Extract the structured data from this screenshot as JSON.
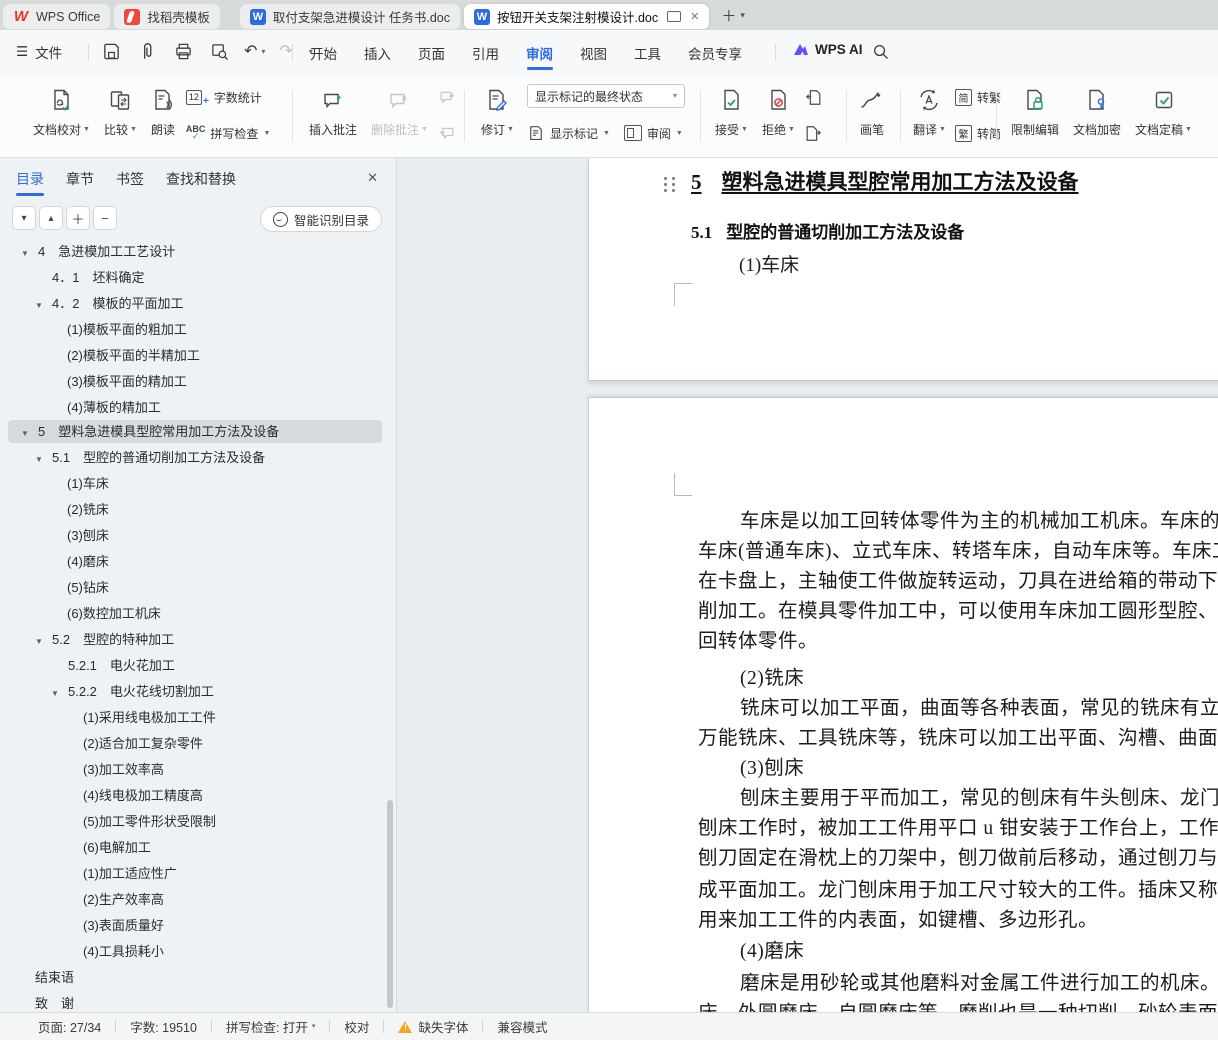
{
  "colors": {
    "accent": "#2e6be5",
    "green": "#2da05a",
    "red": "#d9414c",
    "warn": "#f2a71d",
    "page_bg": "#e8eef0"
  },
  "glyphs": {
    "tri_down": "▼",
    "caret": "▾",
    "caret_up": "▴",
    "plus": "＋",
    "minus": "−",
    "close": "✕",
    "hamburger": "☰",
    "undo": "↶",
    "redo": "↷",
    "check": "✓",
    "slash": "⊘",
    "letter_a": "a",
    "abc": "ABC",
    "num12": "12",
    "plus_s": "+",
    "zh": "文",
    "en": "A",
    "launcher": "◢",
    "warn_mark": "!"
  },
  "titlebar": {
    "tabs": [
      {
        "label": "WPS Office"
      },
      {
        "label": "找稻壳模板"
      },
      {
        "label": "取付支架急进模设计 任务书.doc"
      },
      {
        "label": "按钮开关支架注射模设计.doc",
        "active": true
      }
    ]
  },
  "menubar": {
    "file_label": "文件",
    "items": [
      "开始",
      "插入",
      "页面",
      "引用",
      "审阅",
      "视图",
      "工具",
      "会员专享"
    ],
    "active_item": "审阅",
    "wps_ai_label": "WPS AI"
  },
  "ribbon": {
    "proof": "文档校对",
    "compare": "比较",
    "read": "朗读",
    "wordcount": "字数统计",
    "spellcheck": "拼写检查",
    "insert_comment": "插入批注",
    "delete_comment": "删除批注",
    "track": "修订",
    "markup_state": "显示标记的最终状态",
    "show_markup": "显示标记",
    "review_pane": "审阅",
    "accept": "接受",
    "reject": "拒绝",
    "brush": "画笔",
    "translate": "翻译",
    "to_trad_icon": "简",
    "to_trad": "转繁",
    "to_simp_icon": "繁",
    "to_simp": "转简",
    "restrict": "限制编辑",
    "encrypt": "文档加密",
    "finalize": "文档定稿"
  },
  "sidebar": {
    "tabs": [
      "目录",
      "章节",
      "书签",
      "查找和替换"
    ],
    "active_tab": "目录",
    "smart_button": "智能识别目录",
    "toc": {
      "items": [
        {
          "label": "4　急进模加工工艺设计"
        },
        {
          "label": "4．1　坯料确定"
        },
        {
          "label": "4．2　模板的平面加工"
        },
        {
          "label": "(1)模板平面的粗加工"
        },
        {
          "label": "(2)模板平面的半精加工"
        },
        {
          "label": "(3)模板平面的精加工"
        },
        {
          "label": "(4)薄板的精加工"
        },
        {
          "label": "5　塑料急进模具型腔常用加工方法及设备",
          "selected": true
        },
        {
          "label": "5.1　型腔的普通切削加工方法及设备"
        },
        {
          "label": "(1)车床"
        },
        {
          "label": "(2)铣床"
        },
        {
          "label": "(3)刨床"
        },
        {
          "label": "(4)磨床"
        },
        {
          "label": "(5)钻床"
        },
        {
          "label": "(6)数控加工机床"
        },
        {
          "label": "5.2　型腔的特种加工"
        },
        {
          "label": "5.2.1　电火花加工"
        },
        {
          "label": "5.2.2　电火花线切割加工"
        },
        {
          "label": "(1)采用线电极加工工件"
        },
        {
          "label": "(2)适合加工复杂零件"
        },
        {
          "label": "(3)加工效率高"
        },
        {
          "label": "(4)线电极加工精度高"
        },
        {
          "label": "(5)加工零件形状受限制"
        },
        {
          "label": "(6)电解加工"
        },
        {
          "label": "(1)加工适应性广"
        },
        {
          "label": "(2)生产效率高"
        },
        {
          "label": "(3)表面质量好"
        },
        {
          "label": "(4)工具损耗小"
        },
        {
          "label": "结束语"
        },
        {
          "label": "致　谢"
        }
      ]
    }
  },
  "document": {
    "page1": {
      "heading_num": "5",
      "heading": "塑料急进模具型腔常用加工方法及设备",
      "sub_num": "5.1",
      "sub": "型腔的普通切削加工方法及设备",
      "item": "(1)车床"
    },
    "page2": {
      "lines": [
        "车床是以加工回转体零件为主的机械加工机床。车床的种类很多，包括卧式",
        "车床(普通车床)、立式车床、转塔车床，自动车床等。车床工作时被加工工件装",
        "在卡盘上，主轴使工件做旋转运动，刀具在进给箱的带动下做直线运动，实现切",
        "削加工。在模具零件加工中，可以使用车床加工圆形型腔、型芯、导柱、导套等",
        "回转体零件。",
        "(2)铣床",
        "铣床可以加工平面，曲面等各种表面，常见的铣床有立式铣床、卧式铣床、",
        "万能铣床、工具铣床等，铣床可以加工出平面、沟槽、曲面等形状。",
        "(3)刨床",
        "刨床主要用于平而加工，常见的刨床有牛头刨床、龙门刨床、插床等。牛头",
        "刨床工作时，被加工工件用平口 u 钳安装于工作台上，工作台可以做左右移动，",
        "刨刀固定在滑枕上的刀架中，刨刀做前后移动，通过刨刀与工件的相对运动，完",
        "成平面加工。龙门刨床用于加工尺寸较大的工件。插床又称立式牛头刨床，常",
        "用来加工工件的内表面，如键槽、多边形孔。",
        "(4)磨床",
        "磨床是用砂轮或其他磨料对金属工件进行加工的机床。常见磨床有平面磨",
        "床、外圆磨床、自圆磨床等。磨削也是一种切削，砂轮表面上的每个磨粒相当"
      ]
    }
  },
  "statusbar": {
    "page": "页面: 27/34",
    "words": "字数: 19510",
    "spell": "拼写检查: 打开",
    "proof": "校对",
    "missing_font": "缺失字体",
    "compat": "兼容模式"
  }
}
